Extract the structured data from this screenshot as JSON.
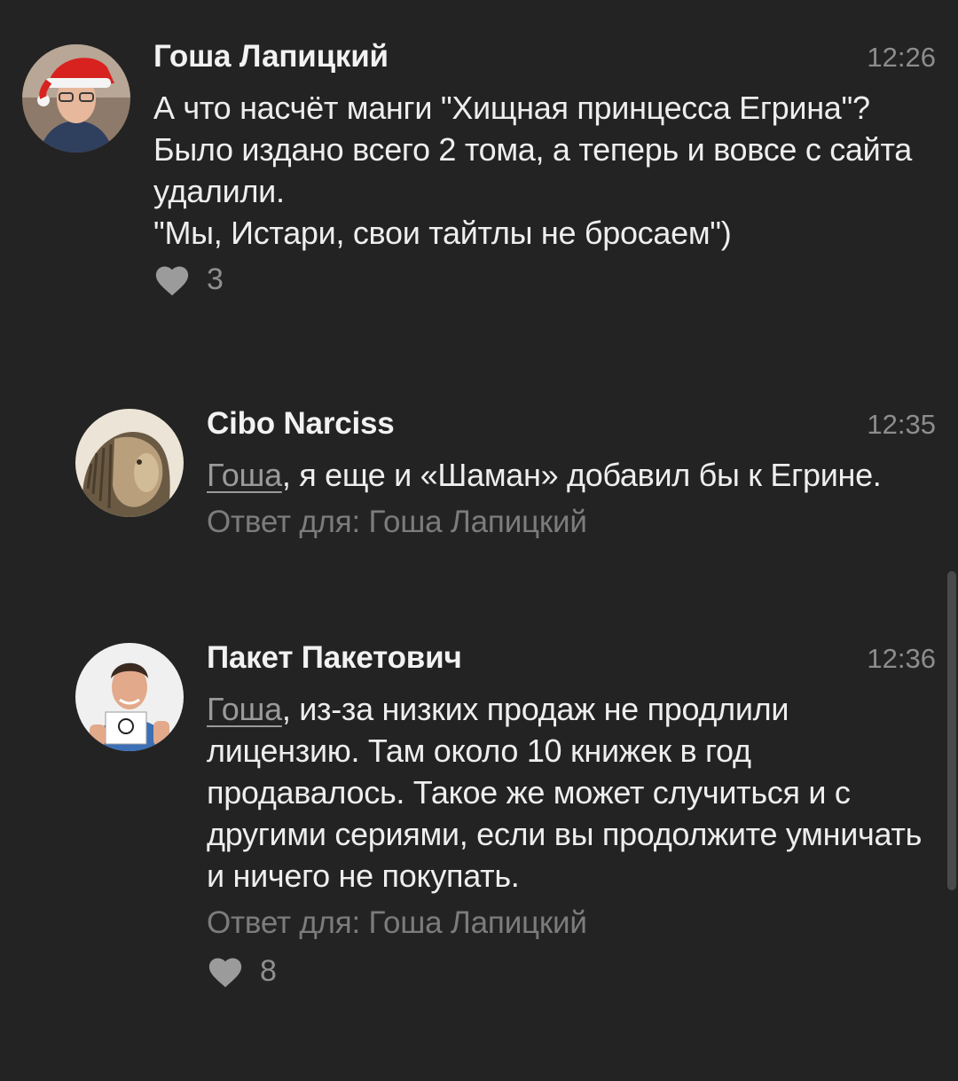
{
  "comments": [
    {
      "author": "Гоша Лапицкий",
      "time": "12:26",
      "avatar_icon": "avatar-santa-hat",
      "text_lines": [
        "А что насчёт манги \"Хищная принцесса Егрина\"?",
        "Было издано всего 2 тома, а теперь и вовсе с сайта удалили.",
        "\"Мы, Истари, свои тайтлы не бросаем\")"
      ],
      "likes": "3"
    },
    {
      "author": "Cibo Narciss",
      "time": "12:35",
      "avatar_icon": "avatar-lion",
      "mention": "Гоша",
      "text": ", я еще и «Шаман» добавил бы к Егрине.",
      "reply_to": "Ответ для: Гоша Лапицкий"
    },
    {
      "author": "Пакет Пакетович",
      "time": "12:36",
      "avatar_icon": "avatar-man-with-sign",
      "mention": "Гоша",
      "text": ", из-за низких продаж не продлили лицензию. Там  около 10 книжек в год продавалось. Такое же может случиться и с другими сериями, если вы продолжите умничать и ничего не покупать.",
      "reply_to": "Ответ для: Гоша Лапицкий",
      "likes": "8"
    }
  ],
  "colors": {
    "background": "#232323",
    "text": "#eeeeee",
    "muted": "#8d8d8d",
    "mention": "#9a9a9a"
  },
  "icons": {
    "like": "heart-icon"
  }
}
